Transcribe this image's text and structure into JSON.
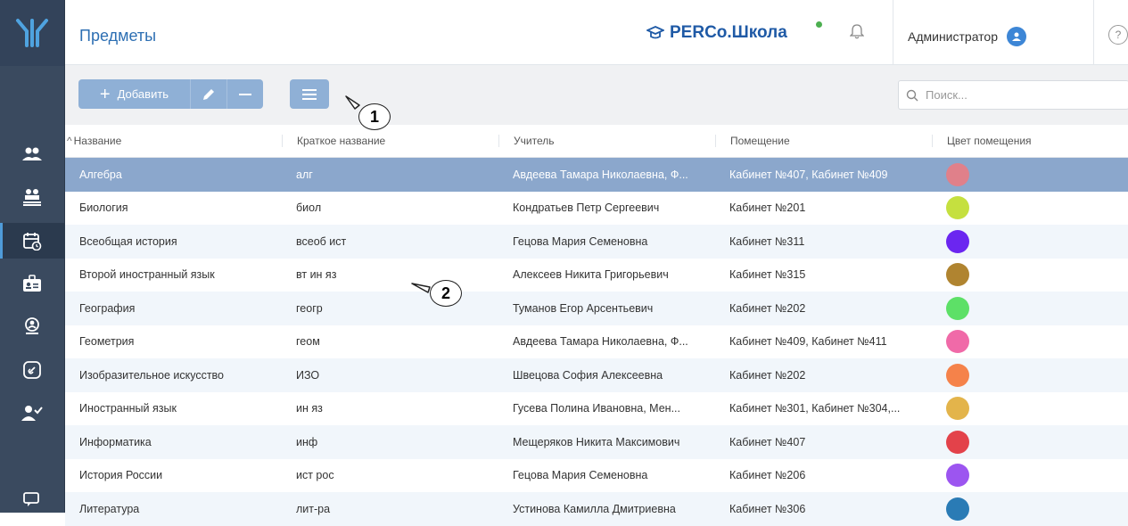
{
  "header": {
    "page_title": "Предметы",
    "brand": "PERCo.Школа",
    "user_name": "Администратор",
    "help_glyph": "?"
  },
  "sidebar": {
    "items": [
      {
        "icon": "users-icon"
      },
      {
        "icon": "groups-icon"
      },
      {
        "icon": "calendar-icon",
        "active": true
      },
      {
        "icon": "id-badge-icon"
      },
      {
        "icon": "person-location-icon"
      },
      {
        "icon": "link-icon"
      },
      {
        "icon": "person-check-icon"
      },
      {
        "icon": "chat-icon"
      }
    ]
  },
  "toolbar": {
    "add_label": "Добавить",
    "search_placeholder": "Поиск..."
  },
  "callouts": {
    "one": "1",
    "two": "2"
  },
  "table": {
    "columns": [
      "Название",
      "Краткое название",
      "Учитель",
      "Помещение",
      "Цвет помещения"
    ],
    "rows": [
      {
        "name": "Алгебра",
        "short": "алг",
        "teacher": "Авдеева Тамара Николаевна, Ф...",
        "room": "Кабинет №407, Кабинет №409",
        "color": "#e0808a",
        "selected": true
      },
      {
        "name": "Биология",
        "short": "биол",
        "teacher": "Кондратьев Петр Сергеевич",
        "room": "Кабинет №201",
        "color": "#c5e03f"
      },
      {
        "name": "Всеобщая история",
        "short": "всеоб ист",
        "teacher": "Гецова Мария Семеновна",
        "room": "Кабинет №311",
        "color": "#6b26f0"
      },
      {
        "name": "Второй иностранный язык",
        "short": "вт ин яз",
        "teacher": "Алексеев Никита Григорьевич",
        "room": "Кабинет №315",
        "color": "#b08430"
      },
      {
        "name": "География",
        "short": "геогр",
        "teacher": "Туманов Егор Арсентьевич",
        "room": "Кабинет №202",
        "color": "#5de067"
      },
      {
        "name": "Геометрия",
        "short": "геом",
        "teacher": "Авдеева Тамара Николаевна, Ф...",
        "room": "Кабинет №409, Кабинет №411",
        "color": "#f06aa8"
      },
      {
        "name": "Изобразительное искусство",
        "short": "ИЗО",
        "teacher": "Швецова София Алексеевна",
        "room": "Кабинет №202",
        "color": "#f5824a"
      },
      {
        "name": "Иностранный язык",
        "short": "ин яз",
        "teacher": "Гусева Полина Ивановна, Мен...",
        "room": "Кабинет №301, Кабинет №304,...",
        "color": "#e3b44b"
      },
      {
        "name": "Информатика",
        "short": "инф",
        "teacher": "Мещеряков Никита Максимович",
        "room": "Кабинет №407",
        "color": "#e3424a"
      },
      {
        "name": "История России",
        "short": "ист рос",
        "teacher": "Гецова Мария Семеновна",
        "room": "Кабинет №206",
        "color": "#9c55f0"
      },
      {
        "name": "Литература",
        "short": "лит-ра",
        "teacher": "Устинова Камилла Дмитриевна",
        "room": "Кабинет №306",
        "color": "#2a7bb5"
      }
    ]
  }
}
